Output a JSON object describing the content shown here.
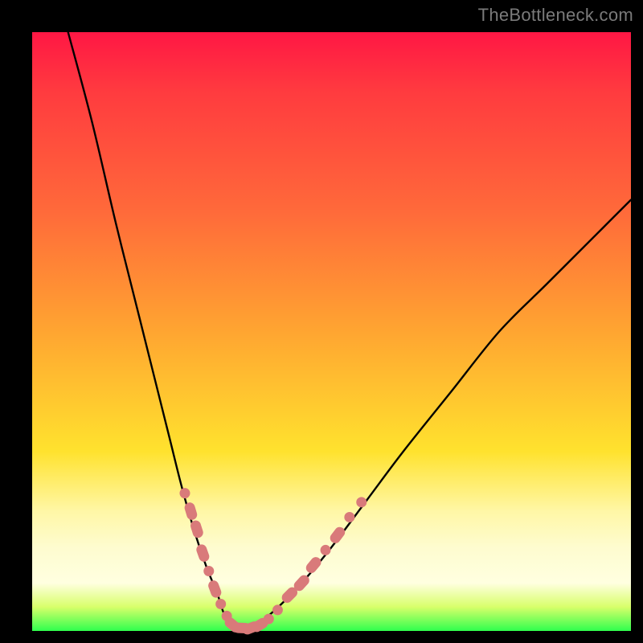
{
  "watermark": "TheBottleneck.com",
  "colors": {
    "frame_bg": "#000000",
    "gradient_top": "#ff1744",
    "gradient_mid1": "#ff6a3a",
    "gradient_mid2": "#ffe22e",
    "gradient_pale": "#fff7a6",
    "gradient_bottom": "#2fff4e",
    "curve_stroke": "#000000",
    "dots_fill": "#d97a7a",
    "dots_pills": "#d97a7a"
  },
  "chart_data": {
    "type": "line",
    "title": "",
    "xlabel": "",
    "ylabel": "",
    "xlim": [
      0,
      100
    ],
    "ylim": [
      0,
      100
    ],
    "series": [
      {
        "name": "bottleneck-curve",
        "x": [
          6,
          10,
          14,
          18,
          21,
          23,
          25,
          27,
          29,
          31,
          32,
          33.5,
          35,
          37,
          40,
          45,
          50,
          56,
          62,
          70,
          78,
          86,
          94,
          100
        ],
        "y": [
          100,
          85,
          68,
          52,
          40,
          32,
          24,
          17,
          11,
          6,
          3,
          1,
          0.5,
          1,
          3,
          8,
          14,
          22,
          30,
          40,
          50,
          58,
          66,
          72
        ]
      }
    ],
    "dot_markers": {
      "comment": "pink dotted/pill markers clustered along the lower arms of the V",
      "points": [
        {
          "x": 25.5,
          "y": 23,
          "shape": "dot"
        },
        {
          "x": 26.5,
          "y": 20,
          "shape": "pill"
        },
        {
          "x": 27.5,
          "y": 17,
          "shape": "pill"
        },
        {
          "x": 28.5,
          "y": 13,
          "shape": "pill"
        },
        {
          "x": 29.5,
          "y": 10,
          "shape": "dot"
        },
        {
          "x": 30.5,
          "y": 7,
          "shape": "pill"
        },
        {
          "x": 31.5,
          "y": 4.5,
          "shape": "dot"
        },
        {
          "x": 32.5,
          "y": 2.5,
          "shape": "dot"
        },
        {
          "x": 33.5,
          "y": 1,
          "shape": "pill"
        },
        {
          "x": 35.0,
          "y": 0.5,
          "shape": "pill"
        },
        {
          "x": 36.5,
          "y": 0.5,
          "shape": "pill"
        },
        {
          "x": 38.0,
          "y": 1,
          "shape": "pill"
        },
        {
          "x": 39.5,
          "y": 2,
          "shape": "dot"
        },
        {
          "x": 41.0,
          "y": 3.5,
          "shape": "dot"
        },
        {
          "x": 43.0,
          "y": 6,
          "shape": "pill"
        },
        {
          "x": 45.0,
          "y": 8,
          "shape": "pill"
        },
        {
          "x": 47.0,
          "y": 11,
          "shape": "pill"
        },
        {
          "x": 49.0,
          "y": 13.5,
          "shape": "dot"
        },
        {
          "x": 51.0,
          "y": 16,
          "shape": "pill"
        },
        {
          "x": 53.0,
          "y": 19,
          "shape": "dot"
        },
        {
          "x": 55.0,
          "y": 21.5,
          "shape": "dot"
        }
      ]
    }
  }
}
